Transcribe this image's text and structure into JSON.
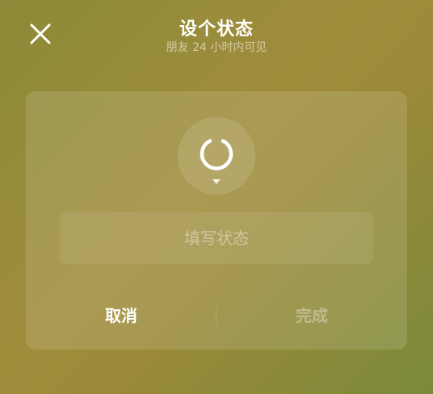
{
  "header": {
    "title": "设个状态",
    "subtitle": "朋友 24 小时内可见",
    "close_icon": "close-icon"
  },
  "card": {
    "status_icon": "loading-ring-icon",
    "input": {
      "placeholder": "填写状态",
      "value": ""
    },
    "cancel_label": "取消",
    "done_label": "完成"
  },
  "colors": {
    "background_start": "#8c8a38",
    "background_end": "#7a8a3a",
    "text_primary": "#ffffff"
  }
}
